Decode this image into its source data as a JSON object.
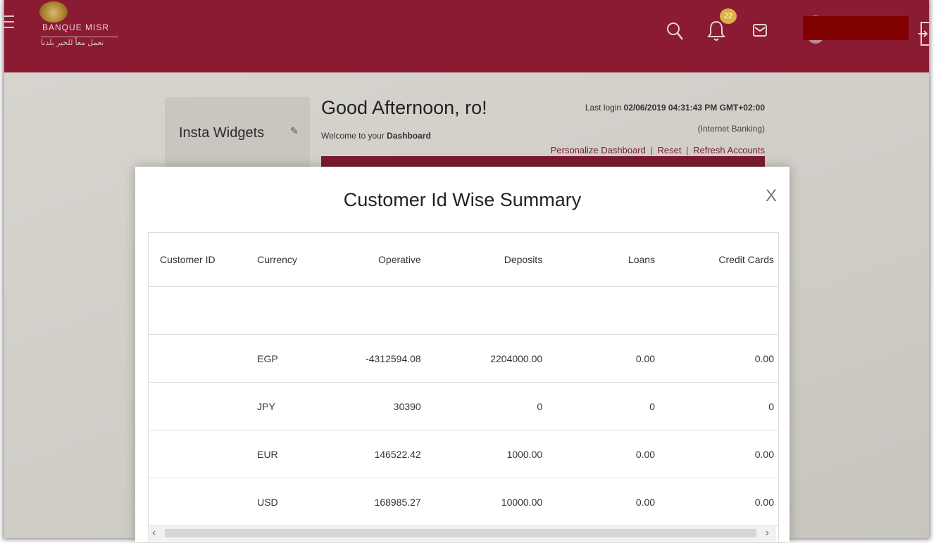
{
  "header": {
    "logo_en": "BANQUE MISR",
    "logo_ar": "نعمل معاً للخير بلدنا",
    "notification_count": "22",
    "colors": {
      "brand": "#8a1b32",
      "badge": "#d8b14a",
      "redaction": "#800000"
    }
  },
  "dashboard": {
    "widgets_title": "Insta Widgets",
    "greeting": "Good Afternoon, ro!",
    "welcome_prefix": "Welcome to your",
    "welcome_bold": "Dashboard",
    "last_login_label": "Last login",
    "last_login_value": "02/06/2019 04:31:43 PM GMT+02:00",
    "channel": "(Internet Banking)",
    "links": [
      "Personalize Dashboard",
      "Reset",
      "Refresh Accounts"
    ],
    "separator": "|"
  },
  "modal": {
    "title": "Customer Id Wise Summary",
    "close_label": "X",
    "columns": [
      "Customer ID",
      "Currency",
      "Operative",
      "Deposits",
      "Loans",
      "Credit Cards"
    ],
    "rows": [
      {
        "customer_id": "",
        "currency": "EGP",
        "operative": "-4312594.08",
        "deposits": "2204000.00",
        "loans": "0.00",
        "credit_cards": "0.00"
      },
      {
        "customer_id": "",
        "currency": "JPY",
        "operative": "30390",
        "deposits": "0",
        "loans": "0",
        "credit_cards": "0"
      },
      {
        "customer_id": "",
        "currency": "EUR",
        "operative": "146522.42",
        "deposits": "1000.00",
        "loans": "0.00",
        "credit_cards": "0.00"
      },
      {
        "customer_id": "",
        "currency": "USD",
        "operative": "168985.27",
        "deposits": "10000.00",
        "loans": "0.00",
        "credit_cards": "0.00"
      }
    ],
    "scroll_left": "‹",
    "scroll_right": "›"
  }
}
